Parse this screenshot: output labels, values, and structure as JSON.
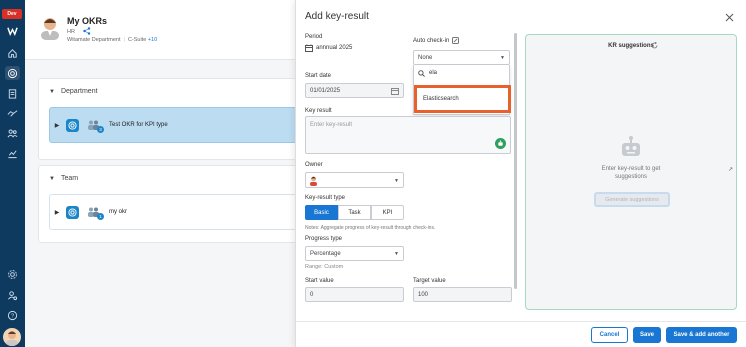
{
  "rail": {
    "badge": "Dev",
    "icons": [
      "logo-icon",
      "home-icon",
      "target-icon",
      "clipboard-icon",
      "handshake-icon",
      "people-icon",
      "chart-icon",
      "settings-icon",
      "user-settings-icon",
      "help-icon"
    ]
  },
  "page": {
    "title": "My OKRs",
    "owner_dept": "HR",
    "org": "Witamate Department",
    "role": "C-Suite",
    "more": "+10",
    "sections": [
      {
        "label": "Department",
        "okr": {
          "name": "Test OKR for KPI type",
          "count": "3"
        }
      },
      {
        "label": "Team",
        "okr": {
          "name": "my okr",
          "count": "1"
        }
      }
    ]
  },
  "modal": {
    "title": "Add key-result",
    "period_label": "Period",
    "period_value": "annnual 2025",
    "auto_checkin_label": "Auto check-in",
    "auto_checkin_value": "None",
    "search_value": "ela",
    "search_option": "Elasticsearch",
    "start_date_label": "Start date",
    "start_date_value": "01/01/2025",
    "key_result_label": "Key result",
    "key_result_placeholder": "Enter key-result",
    "owner_label": "Owner",
    "kr_type_label": "Key-result type",
    "kr_types": [
      "Basic",
      "Task",
      "KPI"
    ],
    "kr_type_selected": "Basic",
    "notes": "Notes: Aggregate progress of key-result through check-ins.",
    "progress_type_label": "Progress type",
    "progress_type_value": "Percentage",
    "range": "Range: Custom",
    "start_value_label": "Start value",
    "start_value": "0",
    "target_value_label": "Target value",
    "target_value": "100"
  },
  "suggestions": {
    "title": "KR suggestions",
    "hint_line1": "Enter key-result to get",
    "hint_line2": "suggestions",
    "button": "Generate suggestions"
  },
  "footer": {
    "cancel": "Cancel",
    "save": "Save",
    "save_add": "Save & add another"
  },
  "colors": {
    "rail": "#0f3a5f",
    "accent": "#1976d2",
    "highlight": "#e8602c",
    "selected_row": "#bcdcf2"
  }
}
